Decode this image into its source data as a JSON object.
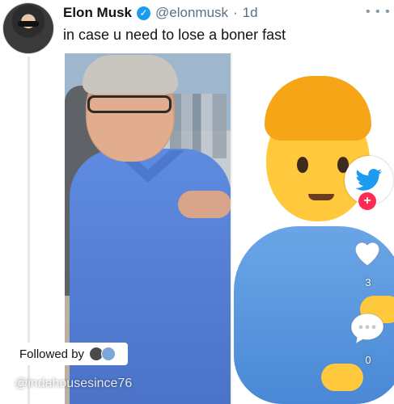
{
  "tweet": {
    "display_name": "Elon Musk",
    "handle": "@elonmusk",
    "separator": "·",
    "age": "1d",
    "text": "in case u need to lose a boner fast",
    "more_icon": "ellipsis-icon"
  },
  "overlay": {
    "followed_by_label": "Followed by",
    "watermark": "@indahousesince76",
    "like_count": "3",
    "comment_count": "0",
    "follow_icon": "plus-icon"
  },
  "colors": {
    "verified": "#1d9bf0",
    "follow_button": "#fe2c55",
    "handle": "#5b7083"
  }
}
